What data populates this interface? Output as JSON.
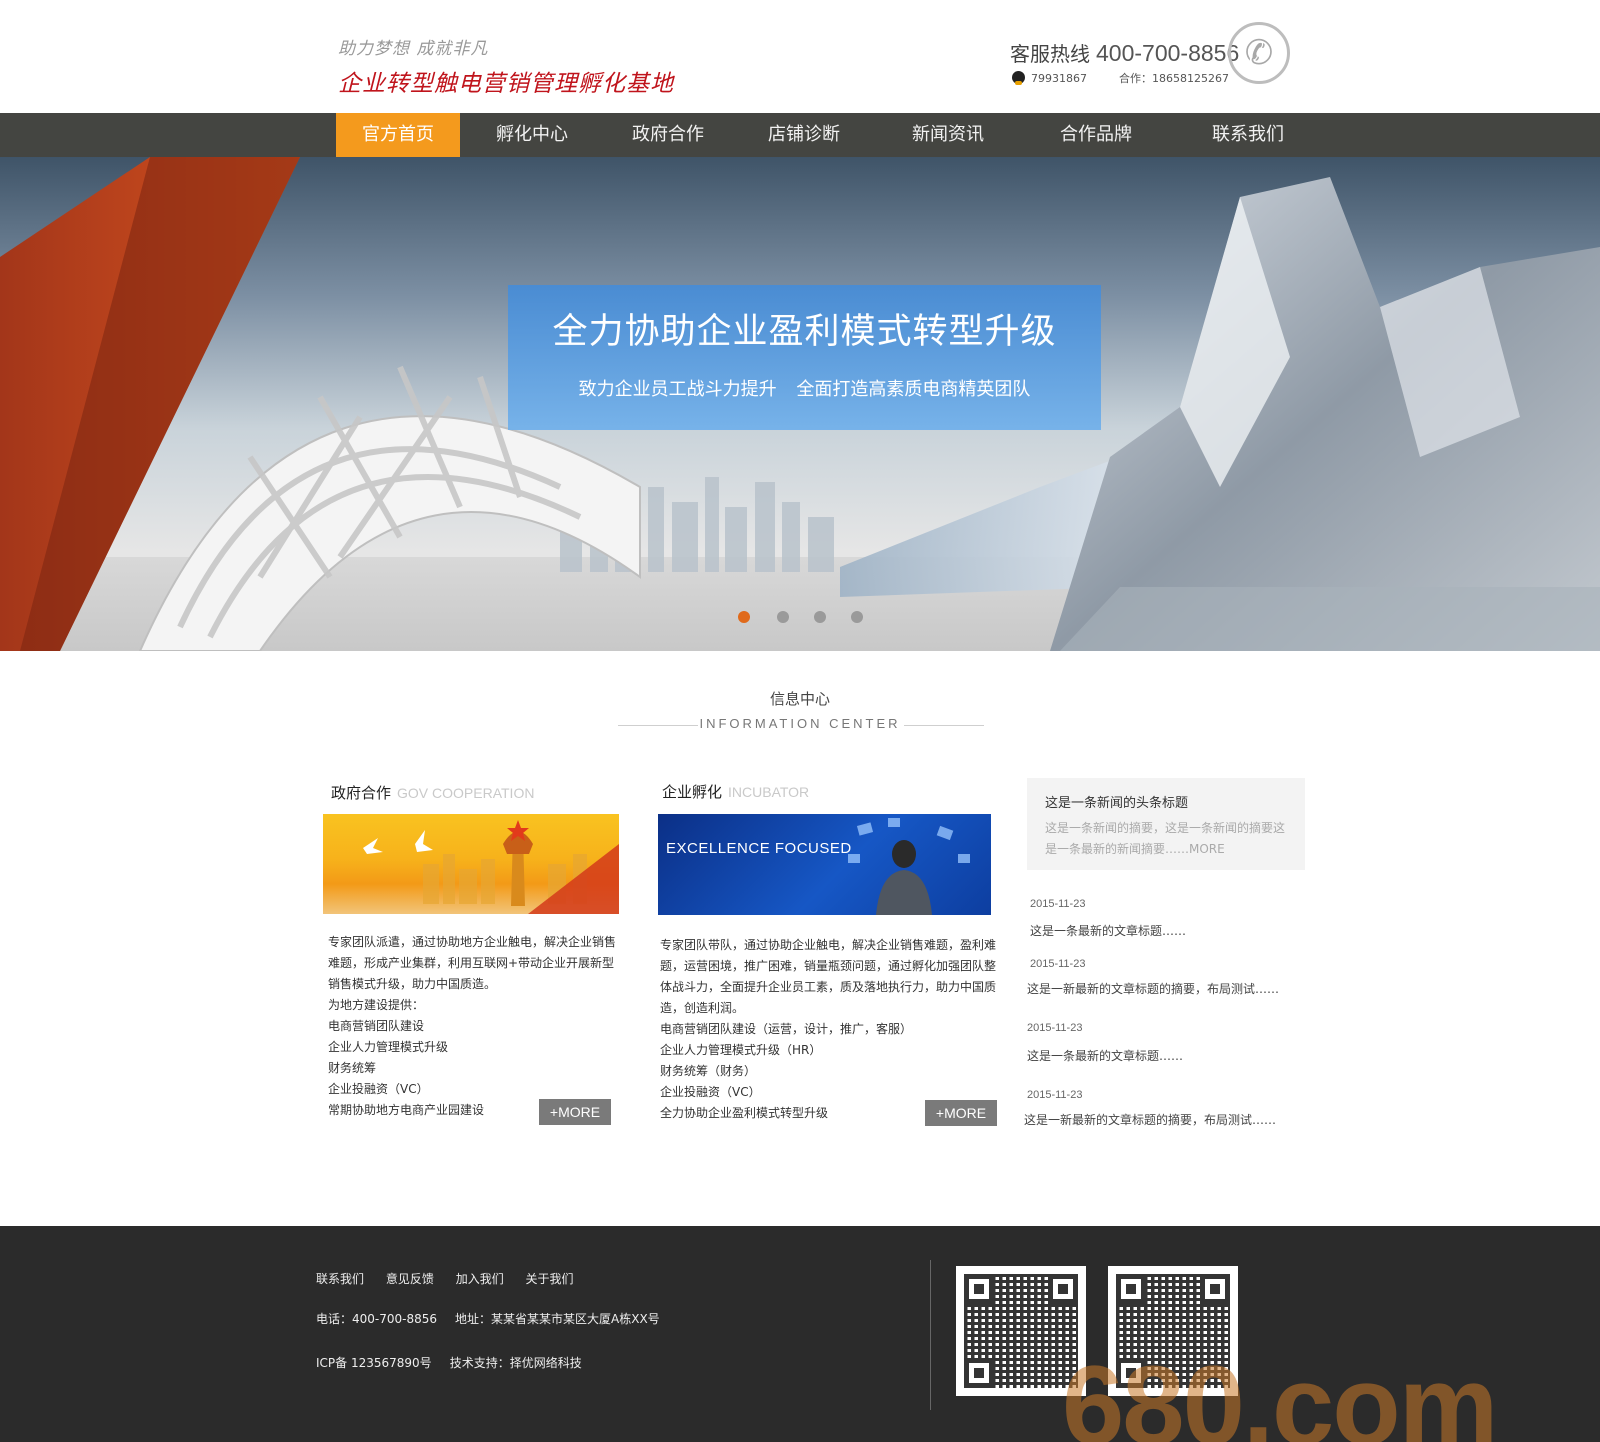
{
  "header": {
    "slogan": "助力梦想 成就非凡",
    "title": "企业转型触电营销管理孵化基地",
    "hotline_label": "客服热线",
    "hotline_number": "400-700-8856",
    "qq": "79931867",
    "coop": "合作：18658125267"
  },
  "nav": {
    "items": [
      {
        "label": "官方首页",
        "active": true
      },
      {
        "label": "孵化中心"
      },
      {
        "label": "政府合作"
      },
      {
        "label": "店铺诊断"
      },
      {
        "label": "新闻资讯"
      },
      {
        "label": "合作品牌"
      },
      {
        "label": "联系我们"
      }
    ]
  },
  "banner": {
    "headline": "全力协助企业盈利模式转型升级",
    "subline": "致力企业员工战斗力提升 全面打造高素质电商精英团队",
    "active_slide": 1,
    "slide_count": 4
  },
  "info_center": {
    "title": "信息中心",
    "subtitle": "INFORMATION CENTER"
  },
  "gov": {
    "title": "政府合作",
    "title_en": "GOV COOPERATION",
    "lines": [
      "专家团队派遣，通过协助地方企业触电，解决企业销售",
      "难题，形成产业集群，利用互联网+带动企业开展新型",
      "销售模式升级，助力中国质造。",
      "为地方建设提供：",
      "电商营销团队建设",
      "企业人力管理模式升级",
      "财务统筹",
      "企业投融资（VC）",
      "常期协助地方电商产业园建设"
    ],
    "more": "+MORE"
  },
  "incubator": {
    "title": "企业孵化",
    "title_en": "INCUBATOR",
    "image_text": "EXCELLENCE FOCUSED",
    "lines": [
      "专家团队带队，通过协助企业触电，解决企业销售难题，盈利难",
      "题，运营困境，推广困难，销量瓶颈问题，通过孵化加强团队整",
      "体战斗力，全面提升企业员工素，质及落地执行力，助力中国质",
      "造，创造利润。",
      "电商营销团队建设（运营，设计，推广，客服）",
      "企业人力管理模式升级（HR）",
      "财务统筹（财务）",
      "企业投融资（VC）",
      "全力协助企业盈利模式转型升级"
    ],
    "more": "+MORE"
  },
  "news": {
    "headline": {
      "title": "这是一条新闻的头条标题",
      "summary": "这是一条新闻的摘要，这是一条新闻的摘要这是一条最新的新闻摘要……MORE"
    },
    "items": [
      {
        "date": "2015-11-23",
        "text": "这是一条最新的文章标题……"
      },
      {
        "date": "2015-11-23",
        "text": "这是一新最新的文章标题的摘要，布局测试……"
      },
      {
        "date": "2015-11-23",
        "text": "这是一条最新的文章标题……"
      },
      {
        "date": "2015-11-23",
        "text": "这是一新最新的文章标题的摘要，布局测试……"
      }
    ]
  },
  "footer": {
    "links": [
      "联系我们",
      "意见反馈",
      "加入我们",
      "关于我们"
    ],
    "phone": "电话：400-700-8856",
    "address": "地址：某某省某某市某区大厦A栋XX号",
    "icp": "ICP备  123567890号",
    "support": "技术支持：择优网络科技",
    "watermark": "680.com"
  },
  "colors": {
    "nav_bg": "#444541",
    "nav_active": "#f49a1d",
    "brand_red": "#c0141c",
    "footer_bg": "#2b2b2b"
  }
}
